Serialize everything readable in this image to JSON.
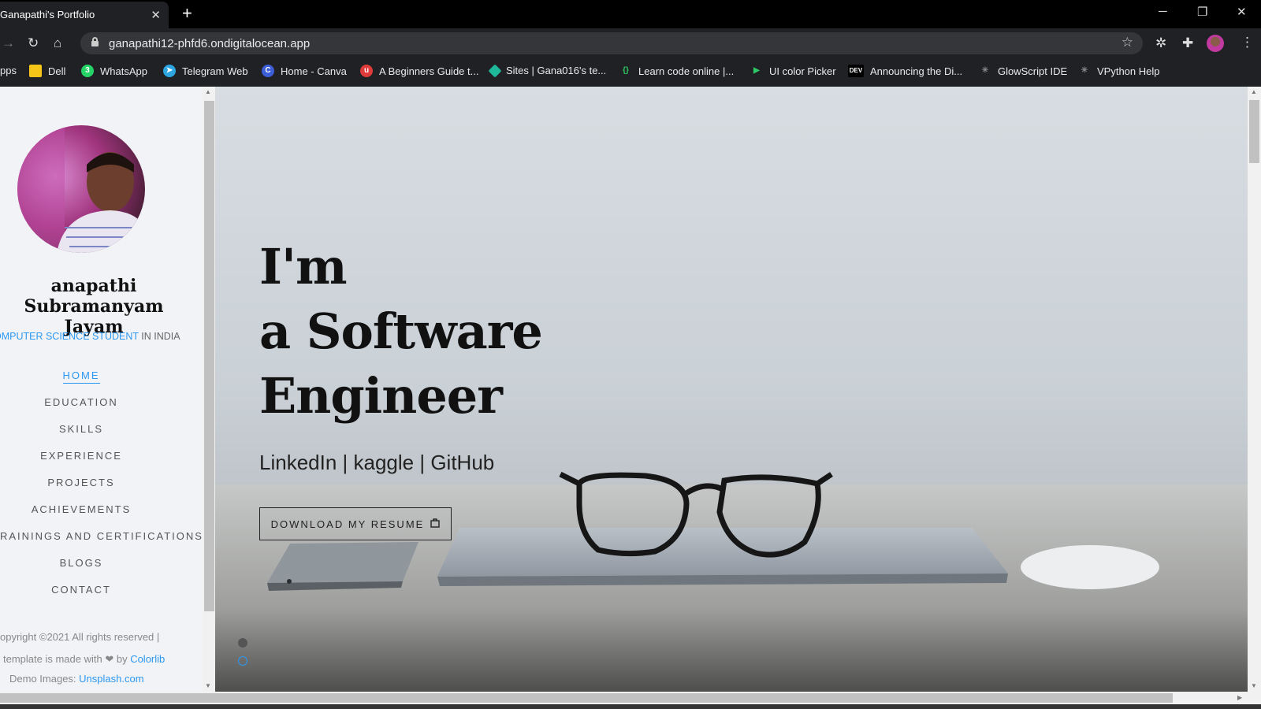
{
  "browser": {
    "tab_title": "Ganapathi's Portfolio",
    "tab_close": "✕",
    "new_tab": "+",
    "url": "ganapathi12-phfd6.ondigitalocean.app",
    "bookmarks": [
      {
        "label": "pps",
        "color": ""
      },
      {
        "label": "Dell",
        "color": "#f5c518"
      },
      {
        "label": "WhatsApp",
        "color": "#25d366"
      },
      {
        "label": "Telegram Web",
        "color": "#2ca5e0"
      },
      {
        "label": "Home - Canva",
        "color": "#3c5ed6"
      },
      {
        "label": "A Beginners Guide t...",
        "color": "#e03b3b"
      },
      {
        "label": "Sites | Gana016's te...",
        "color": "#1fb89a"
      },
      {
        "label": "Learn code online |...",
        "color": "#2ec866"
      },
      {
        "label": "UI color Picker",
        "color": "#2ec866"
      },
      {
        "label": "Announcing the Di...",
        "color": "#000000"
      },
      {
        "label": "GlowScript IDE",
        "color": "#888888"
      },
      {
        "label": "VPython Help",
        "color": "#888888"
      }
    ]
  },
  "sidebar": {
    "name_line1": "anapathi Subramanyam",
    "name_line2": "Jayam",
    "tagline_accent": "OMPUTER SCIENCE STUDENT",
    "tagline_rest": " IN INDIA",
    "nav": [
      "HOME",
      "EDUCATION",
      "SKILLS",
      "EXPERIENCE",
      "PROJECTS",
      "ACHIEVEMENTS",
      "RAININGS AND CERTIFICATIONS",
      "BLOGS",
      "CONTACT"
    ],
    "copyright": "opyright ©2021 All rights reserved |",
    "made_with": "template is made with ❤ by ",
    "made_with_link": "Colorlib",
    "demo_images": "Demo Images: ",
    "demo_images_link": "Unsplash.com"
  },
  "hero": {
    "line1": "I'm",
    "line2": "a Software",
    "line3": "Engineer",
    "links": "LinkedIn | kaggle | GitHub",
    "resume_button": "DOWNLOAD MY RESUME"
  },
  "colors": {
    "accent": "#2c98f0",
    "chrome_bg": "#202124"
  },
  "icons": [
    "close-icon",
    "plus-icon",
    "minimize-icon",
    "restore-icon",
    "back-icon",
    "reload-icon",
    "home-icon",
    "lock-icon",
    "star-icon",
    "puzzle-icon",
    "briefcase-icon"
  ]
}
